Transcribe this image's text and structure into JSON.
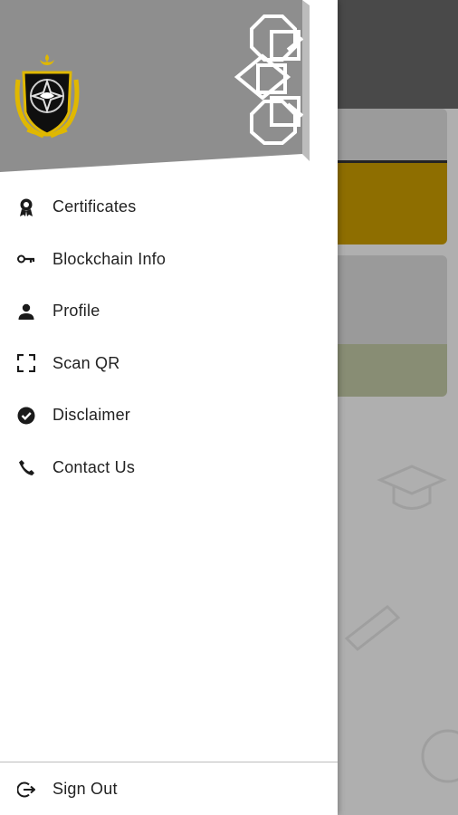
{
  "app": {
    "colors": {
      "header_gray": "#8e8e8e",
      "accent_gold": "#ae8700",
      "accent_olive": "#a7ad8e",
      "appbar": "#5a5a5a"
    }
  },
  "drawer": {
    "logo_icon": "university-crest-icon",
    "menu": [
      {
        "label": "Certificates",
        "icon": "award-ribbon-icon"
      },
      {
        "label": "Blockchain Info",
        "icon": "key-icon"
      },
      {
        "label": "Profile",
        "icon": "person-icon"
      },
      {
        "label": "Scan QR",
        "icon": "scan-frame-icon"
      },
      {
        "label": "Disclaimer",
        "icon": "check-circle-icon"
      },
      {
        "label": "Contact Us",
        "icon": "phone-icon"
      }
    ],
    "footer": {
      "label": "Sign Out",
      "icon": "logout-icon"
    }
  }
}
